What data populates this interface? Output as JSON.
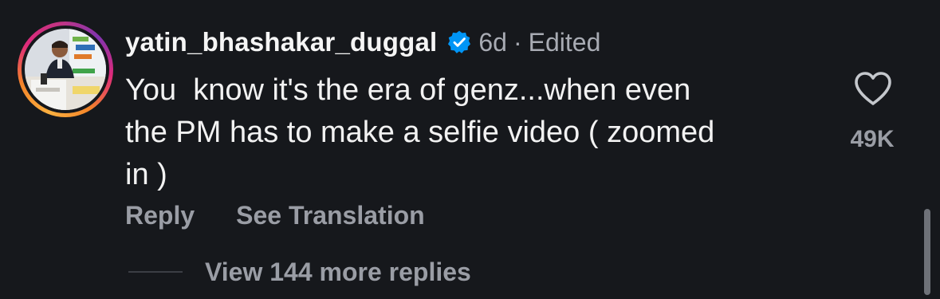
{
  "comment": {
    "username": "yatin_bhashakar_duggal",
    "verified_icon": "verified-badge-icon",
    "time_ago": "6d",
    "separator": "·",
    "edited_label": "Edited",
    "text": "You  know it's the era of genz...when even\nthe PM has to make a selfie video ( zoomed\nin )",
    "like_icon": "heart-outline-icon",
    "like_count": "49K",
    "reply_label": "Reply",
    "translate_label": "See Translation",
    "view_replies_label": "View 144 more replies"
  },
  "colors": {
    "background": "#16181c",
    "primary_text": "#f2f2f2",
    "secondary_text": "#9a9da5",
    "verified_blue": "#0095f6",
    "story_ring_start": "#fbb040",
    "story_ring_end": "#c13584"
  }
}
